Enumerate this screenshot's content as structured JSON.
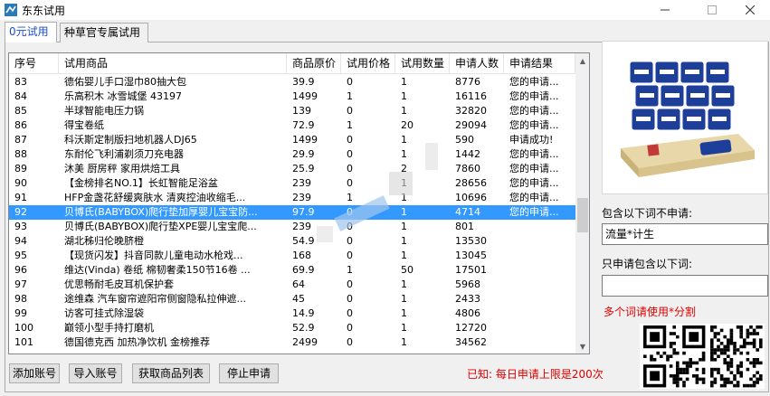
{
  "window": {
    "title": "东东试用",
    "min_icon": "minimize-icon",
    "max_icon": "maximize-icon",
    "close_icon": "close-icon"
  },
  "tabs": [
    {
      "label": "0元试用"
    },
    {
      "label": "种草官专属试用"
    }
  ],
  "table": {
    "headers": [
      "序号",
      "试用商品",
      "商品原价",
      "试用价格",
      "试用数量",
      "申请人数",
      "申请结果"
    ],
    "rows": [
      [
        "83",
        "德佑婴儿手口湿巾80抽大包",
        "39.9",
        "0",
        "1",
        "8776",
        "您的申请..."
      ],
      [
        "84",
        "乐高积木 冰雪城堡 43197",
        "1499",
        "1",
        "1",
        "16116",
        "您的申请..."
      ],
      [
        "85",
        "半球智能电压力锅",
        "139",
        "0",
        "1",
        "32820",
        "您的申请..."
      ],
      [
        "86",
        "得宝卷纸",
        "72.9",
        "1",
        "20",
        "29094",
        "您的申请..."
      ],
      [
        "87",
        "科沃斯定制版扫地机器人DJ65",
        "1499",
        "0",
        "1",
        "590",
        "申请成功!"
      ],
      [
        "88",
        "东耐伦飞利浦剃须刀充电器",
        "29.9",
        "0",
        "1",
        "1442",
        "您的申请..."
      ],
      [
        "89",
        "沐美 厨房秤 家用烘焙工具",
        "25.9",
        "0",
        "2",
        "7860",
        "您的申请..."
      ],
      [
        "90",
        "【金榜排名NO.1】长虹智能足浴盆",
        "239",
        "0",
        "1",
        "28656",
        "您的申请..."
      ],
      [
        "91",
        "HFP金盏花舒缓爽肤水 清爽控油收缩毛...",
        "239",
        "1",
        "1",
        "10696",
        "您的申请..."
      ],
      [
        "92",
        "贝博氏(BABYBOX)爬行垫加厚婴儿宝宝防...",
        "97.9",
        "0",
        "1",
        "4714",
        "您的申请..."
      ],
      [
        "93",
        "贝博氏(BABYBOX)爬行垫XPE婴儿宝宝爬...",
        "239",
        "0",
        "1",
        "801",
        ""
      ],
      [
        "94",
        "湖北秭归伦晚脐橙",
        "54.9",
        "0",
        "1",
        "13530",
        ""
      ],
      [
        "95",
        "【现货闪发】抖音同款儿童电动水枪戏...",
        "168",
        "0",
        "1",
        "13045",
        ""
      ],
      [
        "96",
        "维达(Vinda) 卷纸 棉韧奢柔150节16卷 ...",
        "69.9",
        "1",
        "50",
        "17501",
        ""
      ],
      [
        "97",
        "优思畅耐毛皮耳机保护套",
        "64",
        "0",
        "1",
        "5968",
        ""
      ],
      [
        "98",
        "途维森 汽车窗帘遮阳帘侧窗隐私拉伸遮...",
        "45",
        "0",
        "1",
        "2433",
        ""
      ],
      [
        "99",
        "访客可挂式除湿袋",
        "14.9",
        "0",
        "1",
        "4806",
        ""
      ],
      [
        "100",
        "巅领小型手持打磨机",
        "52.9",
        "0",
        "1",
        "12720",
        ""
      ],
      [
        "101",
        "德国德克西 加热净饮机 金榜推荐",
        "2499",
        "0",
        "1",
        "34562",
        ""
      ]
    ],
    "selected_index": 9
  },
  "scrollbar": {
    "up_icon": "scroll-up-arrow-icon",
    "down_icon": "scroll-down-arrow-icon"
  },
  "buttons": {
    "add_account": "添加账号",
    "import_account": "导入账号",
    "fetch_list": "获取商品列表",
    "stop_apply": "停止申请"
  },
  "notice": "已知: 每日申请上限是200次",
  "filters": {
    "exclude_label": "包含以下词不申请:",
    "exclude_value": "流量*计生",
    "include_label": "只申请包含以下词:",
    "include_value": "",
    "hint": "多个词请使用*分割"
  },
  "colors": {
    "selection": "#3399ff",
    "accent_text": "#1a4fcc",
    "warning": "#e00000"
  }
}
